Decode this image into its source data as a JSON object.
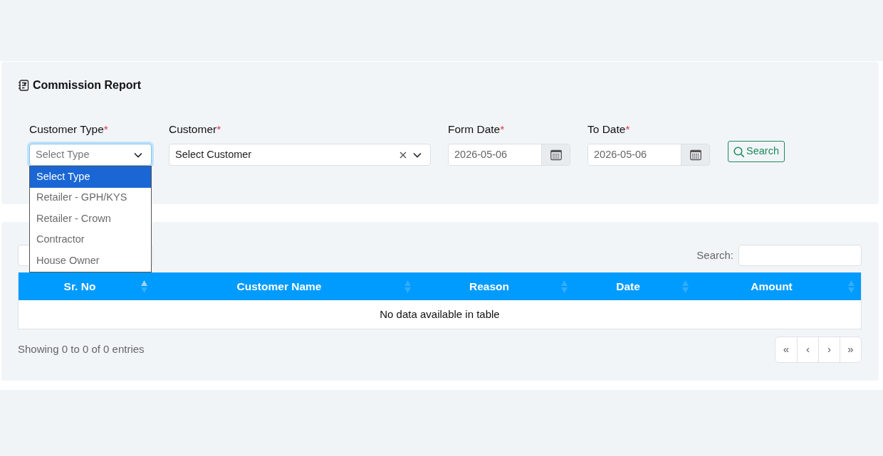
{
  "report": {
    "title": "Commission Report",
    "filters": [
      {
        "kind": "select",
        "label": "Customer Type",
        "required_mark": "*",
        "placeholder": "Select Type",
        "expanded": true,
        "options": [
          {
            "label": "Select Type",
            "selected": true
          },
          {
            "label": "Retailer - GPH/KYS",
            "selected": false
          },
          {
            "label": "Retailer - Crown",
            "selected": false
          },
          {
            "label": "Contractor",
            "selected": false
          },
          {
            "label": "House Owner",
            "selected": false
          }
        ]
      },
      {
        "kind": "select",
        "label": "Customer",
        "required_mark": "*",
        "value": "Select Customer",
        "clearable": true,
        "expanded": false
      },
      {
        "kind": "date",
        "label": "Form Date",
        "required_mark": "*",
        "value": "2026-05-06"
      },
      {
        "kind": "date",
        "label": "To Date",
        "required_mark": "*",
        "value": "2026-05-06"
      }
    ],
    "search_button": {
      "label": "Search"
    }
  },
  "results": {
    "search_label": "Search:",
    "columns": [
      {
        "label": "Sr. No",
        "sorted": true
      },
      {
        "label": "Customer Name",
        "sorted": false
      },
      {
        "label": "Reason",
        "sorted": false
      },
      {
        "label": "Date",
        "sorted": false
      },
      {
        "label": "Amount",
        "sorted": false
      }
    ],
    "empty_message": "No data available in table",
    "info": "Showing 0 to 0 of 0 entries",
    "pagination": [
      {
        "label": "«"
      },
      {
        "label": "‹"
      },
      {
        "label": "›"
      },
      {
        "label": "»"
      }
    ]
  }
}
